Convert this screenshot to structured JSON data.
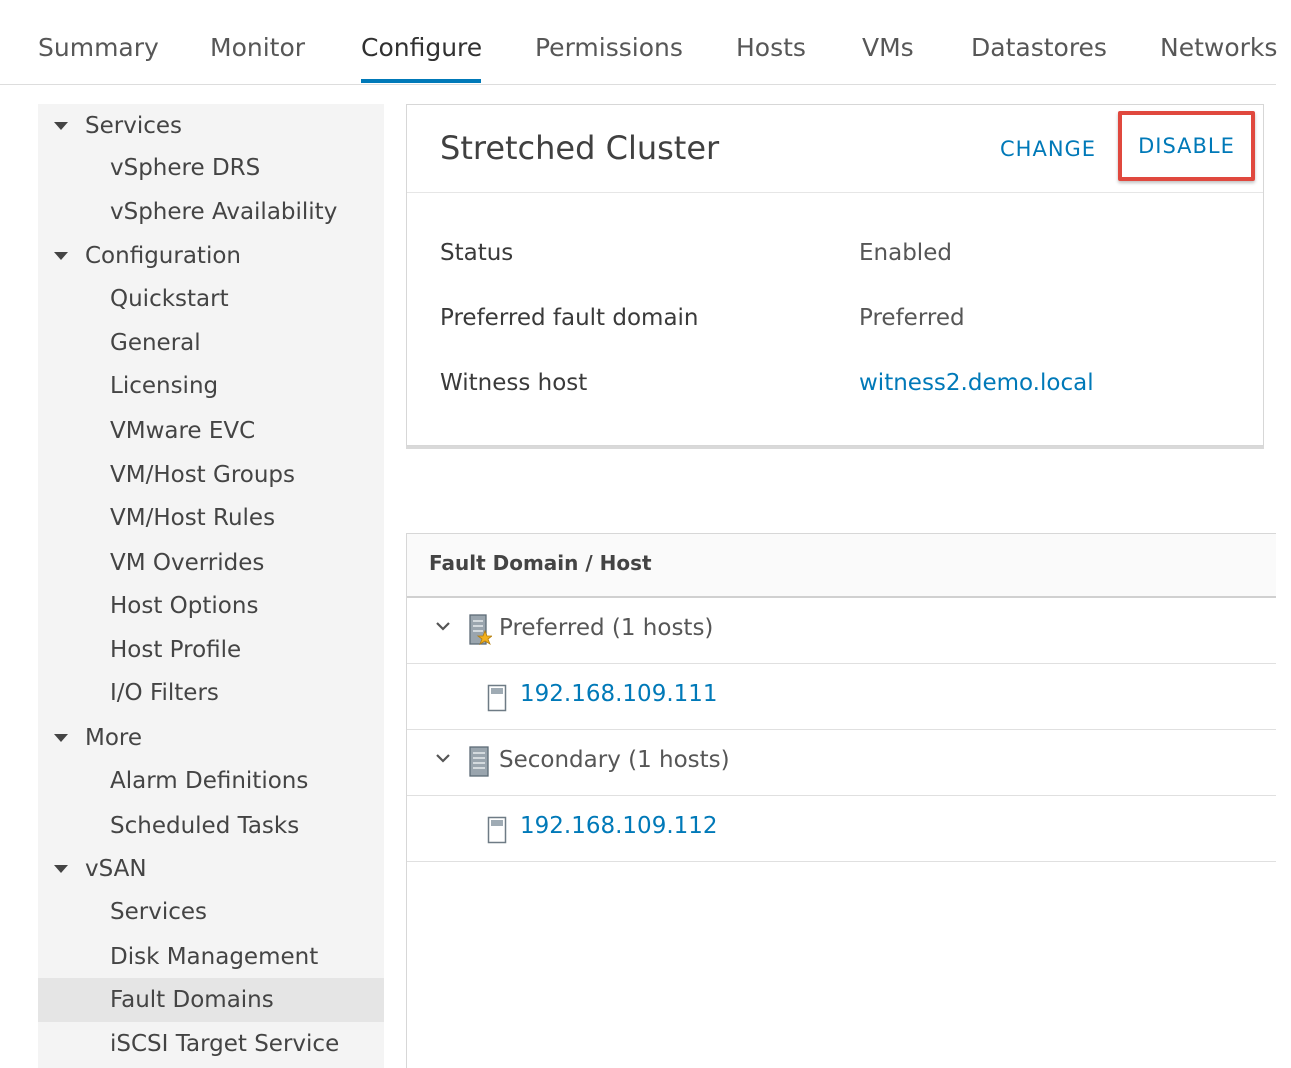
{
  "tabs": [
    {
      "label": "Summary",
      "active": false
    },
    {
      "label": "Monitor",
      "active": false
    },
    {
      "label": "Configure",
      "active": true
    },
    {
      "label": "Permissions",
      "active": false
    },
    {
      "label": "Hosts",
      "active": false
    },
    {
      "label": "VMs",
      "active": false
    },
    {
      "label": "Datastores",
      "active": false
    },
    {
      "label": "Networks",
      "active": false
    }
  ],
  "sidebar": {
    "sections": [
      {
        "label": "Services",
        "expanded": true,
        "items": [
          "vSphere DRS",
          "vSphere Availability"
        ]
      },
      {
        "label": "Configuration",
        "expanded": true,
        "items": [
          "Quickstart",
          "General",
          "Licensing",
          "VMware EVC",
          "VM/Host Groups",
          "VM/Host Rules",
          "VM Overrides",
          "Host Options",
          "Host Profile",
          "I/O Filters"
        ]
      },
      {
        "label": "More",
        "expanded": true,
        "items": [
          "Alarm Definitions",
          "Scheduled Tasks"
        ]
      },
      {
        "label": "vSAN",
        "expanded": true,
        "items": [
          "Services",
          "Disk Management",
          "Fault Domains",
          "iSCSI Target Service"
        ]
      }
    ],
    "selected": "Fault Domains"
  },
  "card": {
    "title": "Stretched Cluster",
    "change_label": "CHANGE",
    "disable_label": "DISABLE",
    "properties": [
      {
        "label": "Status",
        "value": "Enabled",
        "is_link": false
      },
      {
        "label": "Preferred fault domain",
        "value": "Preferred",
        "is_link": false
      },
      {
        "label": "Witness host",
        "value": "witness2.demo.local",
        "is_link": true
      }
    ]
  },
  "grid": {
    "column_header": "Fault Domain / Host",
    "rows": [
      {
        "type": "group",
        "label": "Preferred (1 hosts)",
        "icon": "preferred-fault-domain-icon",
        "expanded": true
      },
      {
        "type": "host",
        "label": "192.168.109.111",
        "icon": "host-icon"
      },
      {
        "type": "group",
        "label": "Secondary (1 hosts)",
        "icon": "fault-domain-icon",
        "expanded": true
      },
      {
        "type": "host",
        "label": "192.168.109.112",
        "icon": "host-icon"
      }
    ]
  },
  "colors": {
    "accent": "#0079b8",
    "highlight_border": "#e0483e",
    "sidebar_bg": "#f4f4f4",
    "sidebar_selected": "#e5e5e5"
  }
}
